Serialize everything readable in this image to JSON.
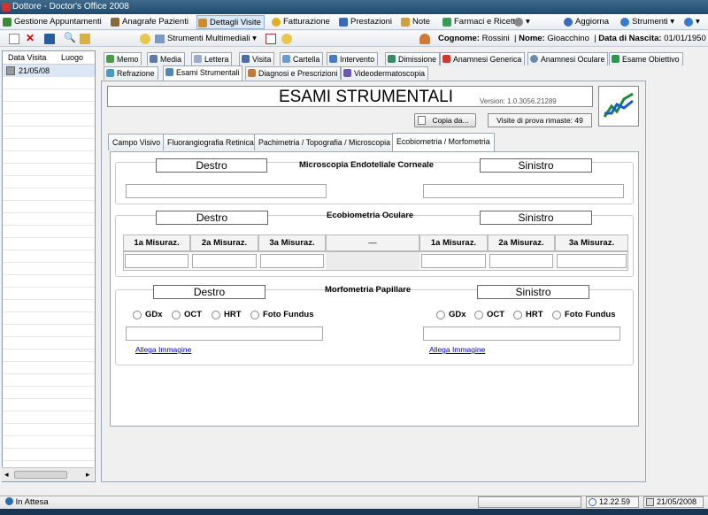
{
  "window": {
    "title": "Dottore - Doctor's Office 2008"
  },
  "menu": [
    {
      "label": "Gestione Appuntamenti",
      "icon": "calendar-icon",
      "color": "#3a8a3a"
    },
    {
      "label": "Anagrafe Pazienti",
      "icon": "people-icon",
      "color": "#8a6a3a"
    },
    {
      "label": "Dettagli Visite",
      "icon": "visit-icon",
      "color": "#d08a2a"
    },
    {
      "label": "Fatturazione",
      "icon": "coins-icon",
      "color": "#e0b020"
    },
    {
      "label": "Prestazioni",
      "icon": "folder-icon",
      "color": "#3a6aba"
    },
    {
      "label": "Note",
      "icon": "note-icon",
      "color": "#d0a040"
    },
    {
      "label": "Farmaci e Ricette",
      "icon": "pills-icon",
      "color": "#3a9a5a"
    },
    {
      "label": "Aggiorna",
      "icon": "globe-icon",
      "color": "#3a6aba"
    },
    {
      "label": "Strumenti",
      "icon": "tools-icon",
      "color": "#3a7aca"
    }
  ],
  "patient": {
    "surname_label": "Cognome:",
    "surname": "Rossini",
    "name_label": "Nome:",
    "name": "Gioacchino",
    "dob_label": "Data di Nascita:",
    "dob": "01/01/1950"
  },
  "toolbar": {
    "multimedia_label": "Strumenti Multimediali"
  },
  "visits": {
    "col_date": "Data Visita",
    "col_place": "Luogo",
    "rows": [
      {
        "date": "21/05/08"
      }
    ]
  },
  "tabs_row1": [
    "Memo",
    "Media",
    "Lettera",
    "Visita",
    "Cartella",
    "Intervento",
    "Dimissione",
    "Anamnesi Generica",
    "Anamnesi Oculare",
    "Esame Obiettivo"
  ],
  "tabs_row2": [
    "Refrazione",
    "Esami Strumentali",
    "Diagnosi e Prescrizioni",
    "Videodermatoscopia"
  ],
  "header": {
    "title": "ESAMI STRUMENTALI",
    "version": "Version: 1.0.3056.21289",
    "copy_button": "Copia da...",
    "trial": "Visite di prova rimaste: 49"
  },
  "subtabs": [
    "Campo Visivo",
    "Fluorangiografia Retinica",
    "Pachimetria / Topografia / Microscopia",
    "Ecobiometria / Morfometria"
  ],
  "sections": {
    "right": "Destro",
    "left": "Sinistro",
    "micro": "Microscopia Endoteliale Corneale",
    "eco": "Ecobiometria Oculare",
    "morfo": "Morfometria Papillare",
    "cols": [
      "1a Misuraz.",
      "2a Misuraz.",
      "3a Misuraz.",
      "—",
      "1a Misuraz.",
      "2a Misuraz.",
      "3a Misuraz."
    ],
    "options": [
      "GDx",
      "OCT",
      "HRT",
      "Foto Fundus"
    ],
    "attach": "Allega Immagine"
  },
  "status": {
    "text": "In Attesa",
    "time": "12.22.59",
    "date": "21/05/2008"
  }
}
